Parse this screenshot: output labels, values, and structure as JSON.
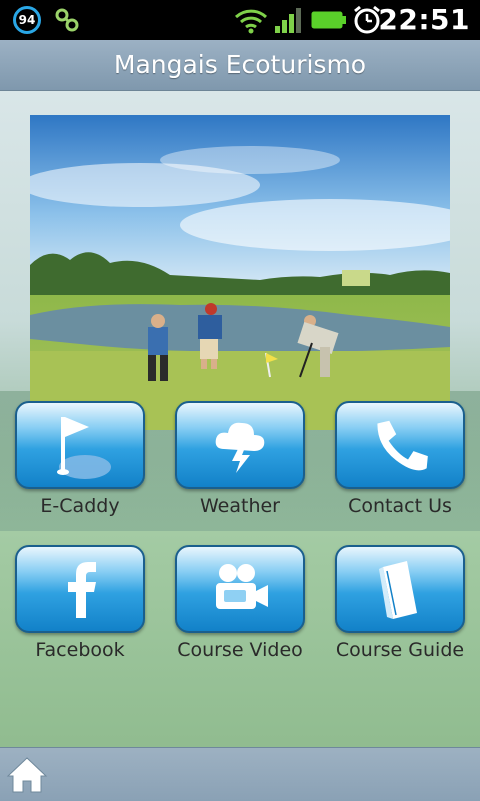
{
  "status_bar": {
    "battery_badge": "94",
    "time": "22:51"
  },
  "header": {
    "title": "Mangais Ecoturismo"
  },
  "tiles": [
    {
      "label": "E-Caddy",
      "icon": "golf-flag-icon"
    },
    {
      "label": "Weather",
      "icon": "weather-storm-icon"
    },
    {
      "label": "Contact Us",
      "icon": "phone-icon"
    },
    {
      "label": "Facebook",
      "icon": "facebook-icon"
    },
    {
      "label": "Course Video",
      "icon": "video-camera-icon"
    },
    {
      "label": "Course Guide",
      "icon": "book-icon"
    }
  ],
  "colors": {
    "tile_top": "#e9f6fd",
    "tile_bottom": "#1281c8",
    "header": "#8fa6ba",
    "accent": "#2aa7e6"
  },
  "footer": {
    "icon": "home-icon"
  }
}
